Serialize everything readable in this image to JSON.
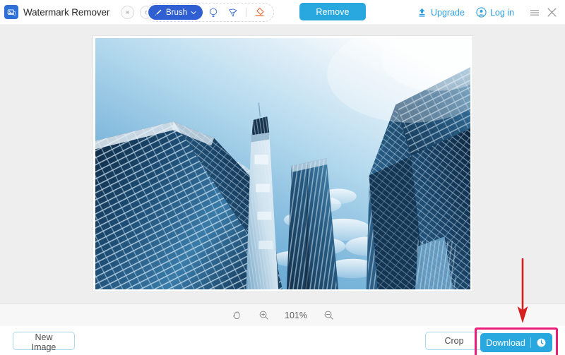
{
  "app": {
    "title": "Watermark Remover",
    "logo_icon": "photo-logo-icon"
  },
  "header": {
    "undo_icon": "undo-arrow-icon",
    "redo_icon": "redo-arrow-icon",
    "tools": {
      "brush": {
        "label": "Brush",
        "icon": "brush-icon",
        "caret": "∨",
        "active": true
      },
      "lasso": {
        "label": "Lasso",
        "icon": "lasso-icon"
      },
      "polygon_lasso": {
        "label": "Polygonal Lasso",
        "icon": "polygon-lasso-icon"
      },
      "eraser": {
        "label": "Eraser",
        "icon": "eraser-icon",
        "color": "#e8672c"
      }
    },
    "remove_button": "Remove",
    "upgrade": {
      "label": "Upgrade",
      "icon": "upload-upgrade-icon"
    },
    "login": {
      "label": "Log in",
      "icon": "user-account-icon"
    },
    "menu_icon": "hamburger-menu-icon",
    "close_icon": "close-icon"
  },
  "canvas": {
    "image_alt": "Low-angle photograph of blue glass skyscrapers against a bright sky"
  },
  "zoombar": {
    "hand_icon": "hand-pan-icon",
    "zoom_in_icon": "zoom-in-icon",
    "zoom_level": "101%",
    "zoom_out_icon": "zoom-out-icon"
  },
  "footer": {
    "new_image": "New Image",
    "crop": "Crop",
    "download": "Download",
    "download_icon": "clock-history-icon"
  },
  "annotations": {
    "arrow": {
      "name": "red-down-arrow",
      "color": "#d62020",
      "points_to": "download-button"
    },
    "highlight_box": {
      "name": "magenta-highlight-box",
      "color": "#ec1d7a",
      "around": "download-button"
    }
  },
  "colors": {
    "brand_blue": "#2f5fd0",
    "action_blue": "#29a8e0",
    "link_blue": "#2f9fe0",
    "canvas_gray": "#eeeeee",
    "annotation_magenta": "#ec1d7a",
    "annotation_red": "#d62020",
    "eraser_orange": "#e8672c"
  }
}
